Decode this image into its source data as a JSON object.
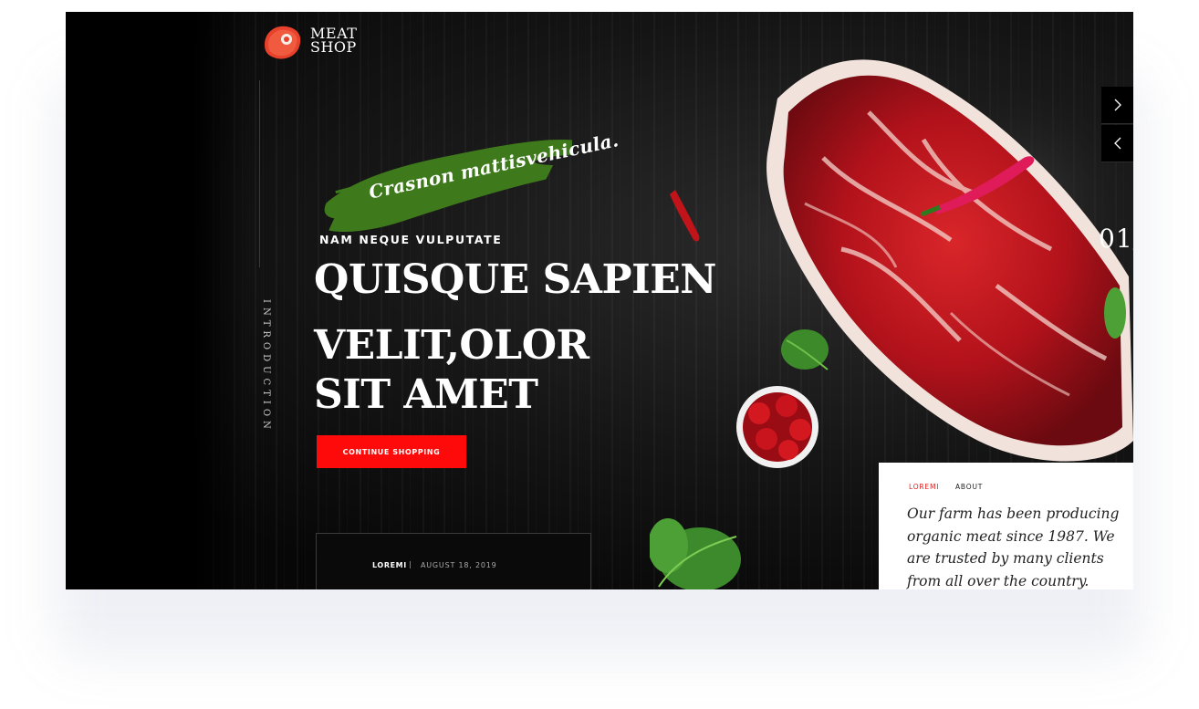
{
  "logo": {
    "line1": "MEAT",
    "line2": "SHOP"
  },
  "sidebar": {
    "label": "INTRODUCTION"
  },
  "hero": {
    "tagline": "Crasnon mattisvehicula.",
    "eyebrow": "NAM NEQUE VULPUTATE",
    "headline_line1": "QUISQUE SAPIEN",
    "headline_line2": "VELIT,OLOR",
    "headline_line3": "SIT AMET",
    "cta_label": "CONTINUE SHOPPING"
  },
  "post": {
    "author": "LOREMI",
    "separator": "|",
    "date": "AUGUST 18, 2019"
  },
  "slider": {
    "number": "01/",
    "next_icon": "chevron-right-icon",
    "prev_icon": "chevron-left-icon"
  },
  "about": {
    "tab_active": "LOREMI",
    "tab_inactive": "ABOUT",
    "text": "Our farm has been producing organic meat since 1987. We are trusted by many clients from all over the country."
  },
  "colors": {
    "accent_red": "#ff0a0a",
    "brush_green": "#3e7a1c",
    "background": "#0b0b0b"
  }
}
